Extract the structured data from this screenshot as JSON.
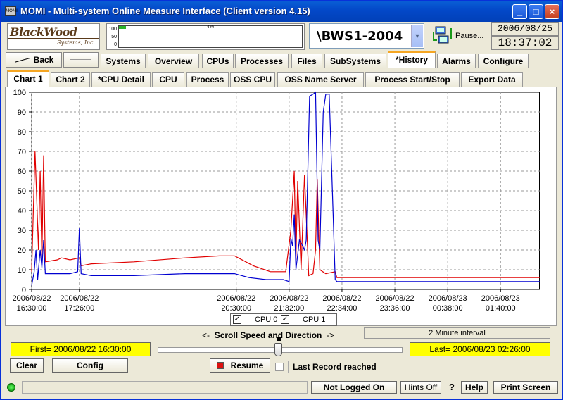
{
  "window": {
    "app_icon": "MOMI",
    "title": "MOMI - Multi-system Online Measure Interface (Client version 4.15)",
    "minimize": "_",
    "maximize": "□",
    "close": "×"
  },
  "header": {
    "logo_line1": "BlackWood",
    "logo_line2": "Systems, Inc.",
    "meter_scale": [
      "100",
      "50",
      "0"
    ],
    "meter_pct_label": "4%",
    "meter_fill_percent": 4,
    "system": "\\BWS1-2004",
    "pause_label": "Pause...",
    "date": "2006/08/25",
    "time": "18:37:02"
  },
  "nav": {
    "back_label": "Back",
    "main_tabs": [
      "Systems",
      "Overview",
      "CPUs",
      "Processes",
      "Files",
      "SubSystems",
      "*History",
      "Alarms",
      "Configure"
    ],
    "active_main_tab": "*History",
    "sub_tabs": [
      "Chart 1",
      "Chart 2",
      "*CPU Detail",
      "CPU",
      "Process",
      "OSS CPU",
      "OSS Name Server",
      "Process Start/Stop",
      "Export Data"
    ],
    "active_sub_tab": "Chart 1"
  },
  "chart_data": {
    "type": "line",
    "ylim": [
      0,
      100
    ],
    "yticks": [
      0,
      10,
      20,
      30,
      40,
      50,
      60,
      70,
      80,
      90,
      100
    ],
    "x_ticks": [
      {
        "date": "2006/08/22",
        "time": "16:30:00"
      },
      {
        "date": "2006/08/22",
        "time": "17:26:00"
      },
      {
        "date": "2006/08/22",
        "time": "20:30:00"
      },
      {
        "date": "2006/08/22",
        "time": "21:32:00"
      },
      {
        "date": "2006/08/22",
        "time": "22:34:00"
      },
      {
        "date": "2006/08/22",
        "time": "23:36:00"
      },
      {
        "date": "2006/08/23",
        "time": "00:38:00"
      },
      {
        "date": "2006/08/23",
        "time": "01:40:00"
      }
    ],
    "series": [
      {
        "name": "CPU 0",
        "color": "#e00000",
        "points": [
          [
            "16:30",
            9
          ],
          [
            "16:32",
            40
          ],
          [
            "16:34",
            70
          ],
          [
            "16:36",
            45
          ],
          [
            "16:38",
            20
          ],
          [
            "16:40",
            60
          ],
          [
            "16:42",
            15
          ],
          [
            "16:44",
            68
          ],
          [
            "16:46",
            14
          ],
          [
            "17:00",
            15
          ],
          [
            "17:05",
            16
          ],
          [
            "17:15",
            15
          ],
          [
            "17:26",
            16
          ],
          [
            "17:28",
            12
          ],
          [
            "17:40",
            13
          ],
          [
            "18:30",
            14
          ],
          [
            "19:30",
            16
          ],
          [
            "20:10",
            17
          ],
          [
            "20:28",
            17
          ],
          [
            "20:50",
            12
          ],
          [
            "21:10",
            9
          ],
          [
            "21:28",
            9
          ],
          [
            "21:34",
            30
          ],
          [
            "21:38",
            60
          ],
          [
            "21:40",
            15
          ],
          [
            "21:42",
            55
          ],
          [
            "21:46",
            10
          ],
          [
            "21:50",
            58
          ],
          [
            "21:55",
            7
          ],
          [
            "22:00",
            8
          ],
          [
            "22:03",
            20
          ],
          [
            "22:05",
            56
          ],
          [
            "22:08",
            10
          ],
          [
            "22:15",
            8
          ],
          [
            "22:26",
            9
          ],
          [
            "22:28",
            6
          ],
          [
            "23:00",
            6
          ],
          [
            "23:36",
            6
          ],
          [
            "00:38",
            6
          ],
          [
            "01:40",
            6
          ],
          [
            "02:26",
            6
          ]
        ]
      },
      {
        "name": "CPU 1",
        "color": "#0000d0",
        "points": [
          [
            "16:30",
            2
          ],
          [
            "16:33",
            9
          ],
          [
            "16:35",
            20
          ],
          [
            "16:37",
            5
          ],
          [
            "16:40",
            20
          ],
          [
            "16:42",
            11
          ],
          [
            "16:44",
            25
          ],
          [
            "16:46",
            8
          ],
          [
            "17:00",
            8
          ],
          [
            "17:15",
            8
          ],
          [
            "17:24",
            9
          ],
          [
            "17:26",
            31
          ],
          [
            "17:28",
            8
          ],
          [
            "17:40",
            7
          ],
          [
            "18:30",
            7
          ],
          [
            "19:30",
            8
          ],
          [
            "20:15",
            8
          ],
          [
            "20:28",
            8
          ],
          [
            "20:45",
            6
          ],
          [
            "21:05",
            5
          ],
          [
            "21:25",
            5
          ],
          [
            "21:32",
            4
          ],
          [
            "21:34",
            26
          ],
          [
            "21:36",
            22
          ],
          [
            "21:38",
            38
          ],
          [
            "21:40",
            10
          ],
          [
            "21:44",
            25
          ],
          [
            "21:48",
            22
          ],
          [
            "21:50",
            20
          ],
          [
            "21:52",
            25
          ],
          [
            "21:56",
            98
          ],
          [
            "22:00",
            99
          ],
          [
            "22:03",
            100
          ],
          [
            "22:06",
            25
          ],
          [
            "22:08",
            20
          ],
          [
            "22:12",
            90
          ],
          [
            "22:15",
            99
          ],
          [
            "22:19",
            99
          ],
          [
            "22:22",
            60
          ],
          [
            "22:26",
            5
          ],
          [
            "22:28",
            4
          ],
          [
            "23:00",
            4
          ],
          [
            "23:36",
            4
          ],
          [
            "00:38",
            4
          ],
          [
            "01:40",
            4
          ],
          [
            "02:26",
            4
          ]
        ]
      }
    ]
  },
  "legend": {
    "cpu0_check": "✓",
    "cpu0_label": "CPU 0",
    "cpu1_check": "✓",
    "cpu1_label": "CPU 1"
  },
  "controls": {
    "scroll_left": "<-",
    "scroll_label": "Scroll Speed and Direction",
    "scroll_right": "->",
    "interval": "2 Minute interval",
    "first": "First= 2006/08/22 16:30:00",
    "last": "Last= 2006/08/23 02:26:00",
    "clear_label": "Clear",
    "config_label": "Config",
    "resume_label": "Resume",
    "last_record": "Last Record reached"
  },
  "status": {
    "not_logged_on": "Not Logged On",
    "hints_off": "Hints Off",
    "qmark": "?",
    "help": "Help",
    "print_screen": "Print Screen"
  }
}
